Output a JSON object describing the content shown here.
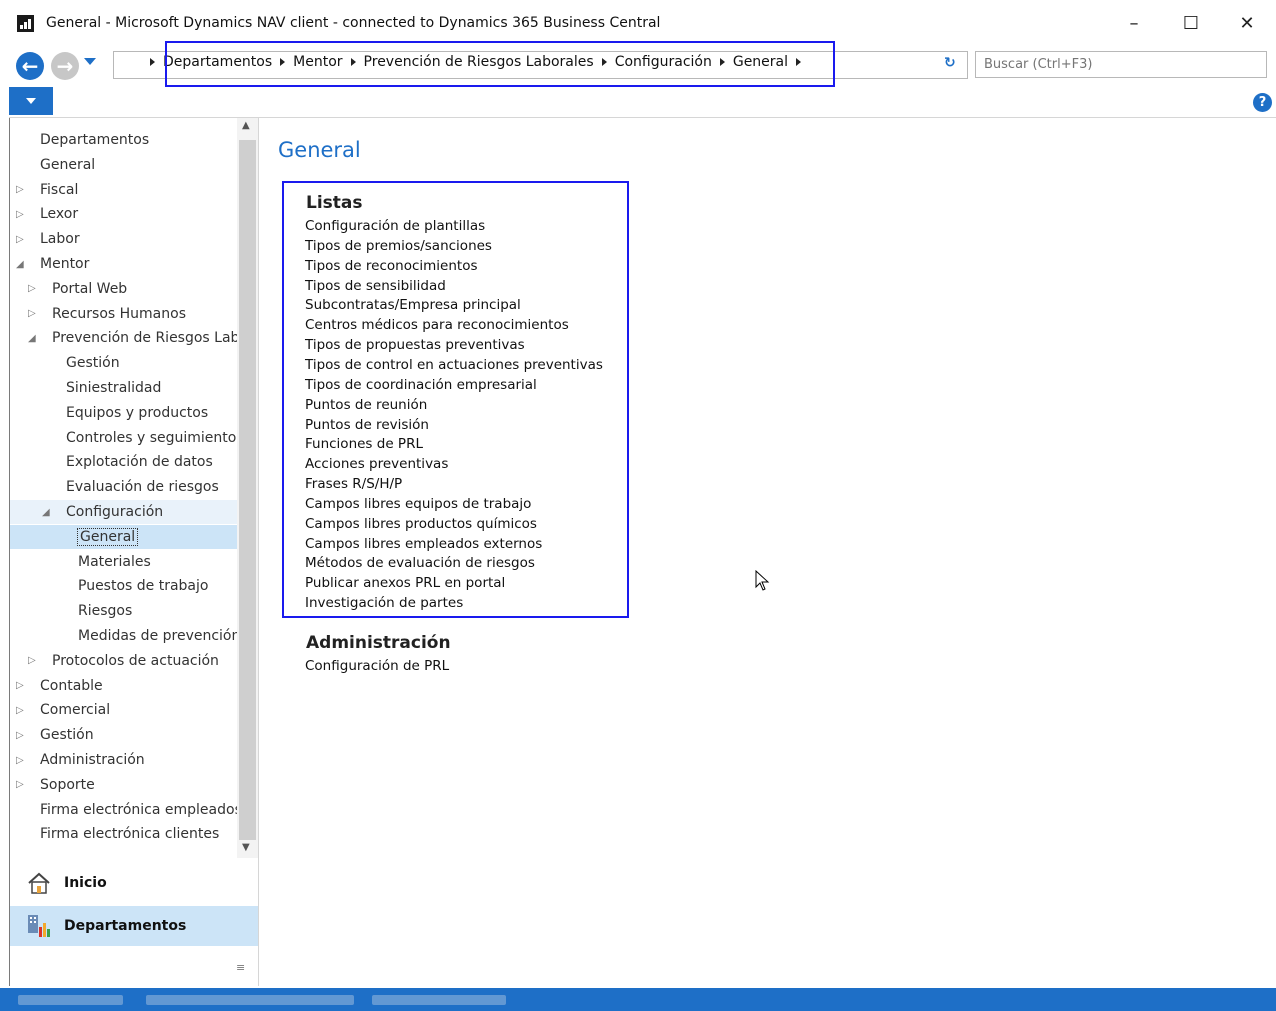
{
  "window": {
    "title": "General - Microsoft Dynamics NAV client - connected to Dynamics 365 Business Central",
    "minimize": "–",
    "maximize": "☐",
    "close": "✕"
  },
  "address": {
    "breadcrumbs": [
      "Departamentos",
      "Mentor",
      "Prevención de Riesgos Laborales",
      "Configuración",
      "General"
    ],
    "search_placeholder": "Buscar (Ctrl+F3)"
  },
  "sidebar": {
    "tree": [
      {
        "label": "Departamentos",
        "level": 0,
        "expander": ""
      },
      {
        "label": "General",
        "level": 0,
        "expander": ""
      },
      {
        "label": "Fiscal",
        "level": 0,
        "expander": "▷"
      },
      {
        "label": "Lexor",
        "level": 0,
        "expander": "▷"
      },
      {
        "label": "Labor",
        "level": 0,
        "expander": "▷"
      },
      {
        "label": "Mentor",
        "level": 0,
        "expander": "◢"
      },
      {
        "label": "Portal Web",
        "level": 1,
        "expander": "▷"
      },
      {
        "label": "Recursos Humanos",
        "level": 1,
        "expander": "▷"
      },
      {
        "label": "Prevención de Riesgos Laborales",
        "level": 1,
        "expander": "◢"
      },
      {
        "label": "Gestión",
        "level": 2,
        "expander": ""
      },
      {
        "label": "Siniestralidad",
        "level": 2,
        "expander": ""
      },
      {
        "label": "Equipos y productos",
        "level": 2,
        "expander": ""
      },
      {
        "label": "Controles y seguimientos",
        "level": 2,
        "expander": ""
      },
      {
        "label": "Explotación de datos",
        "level": 2,
        "expander": ""
      },
      {
        "label": "Evaluación de riesgos",
        "level": 2,
        "expander": ""
      },
      {
        "label": "Configuración",
        "level": 2,
        "expander": "◢"
      },
      {
        "label": "General",
        "level": 3,
        "expander": "",
        "selected": true
      },
      {
        "label": "Materiales",
        "level": 3,
        "expander": ""
      },
      {
        "label": "Puestos de trabajo",
        "level": 3,
        "expander": ""
      },
      {
        "label": "Riesgos",
        "level": 3,
        "expander": ""
      },
      {
        "label": "Medidas de prevención",
        "level": 3,
        "expander": ""
      },
      {
        "label": "Protocolos de actuación",
        "level": 1,
        "expander": "▷"
      },
      {
        "label": "Contable",
        "level": 0,
        "expander": "▷"
      },
      {
        "label": "Comercial",
        "level": 0,
        "expander": "▷"
      },
      {
        "label": "Gestión",
        "level": 0,
        "expander": "▷"
      },
      {
        "label": "Administración",
        "level": 0,
        "expander": "▷"
      },
      {
        "label": "Soporte",
        "level": 0,
        "expander": "▷"
      },
      {
        "label": "Firma electrónica empleados",
        "level": 0,
        "expander": ""
      },
      {
        "label": "Firma electrónica clientes",
        "level": 0,
        "expander": ""
      }
    ],
    "nav_buttons": [
      {
        "label": "Inicio",
        "icon": "home-icon"
      },
      {
        "label": "Departamentos",
        "icon": "departments-icon",
        "active": true
      }
    ]
  },
  "main": {
    "title": "General",
    "groups": [
      {
        "title": "Listas",
        "items": [
          "Configuración de plantillas",
          "Tipos de premios/sanciones",
          "Tipos de reconocimientos",
          "Tipos de sensibilidad",
          "Subcontratas/Empresa principal",
          "Centros médicos para reconocimientos",
          "Tipos de propuestas preventivas",
          "Tipos de control en actuaciones preventivas",
          "Tipos de coordinación empresarial",
          "Puntos de reunión",
          "Puntos de revisión",
          "Funciones de PRL",
          "Acciones preventivas",
          "Frases R/S/H/P",
          "Campos libres equipos de trabajo",
          "Campos libres productos químicos",
          "Campos libres empleados externos",
          "Métodos de evaluación de riesgos",
          "Publicar anexos PRL en portal",
          "Investigación de partes"
        ]
      },
      {
        "title": "Administración",
        "items": [
          "Configuración de PRL"
        ]
      }
    ]
  },
  "colors": {
    "accent": "#1e6fc7",
    "highlight_box": "#1a1aee",
    "selection": "#cce4f7"
  }
}
